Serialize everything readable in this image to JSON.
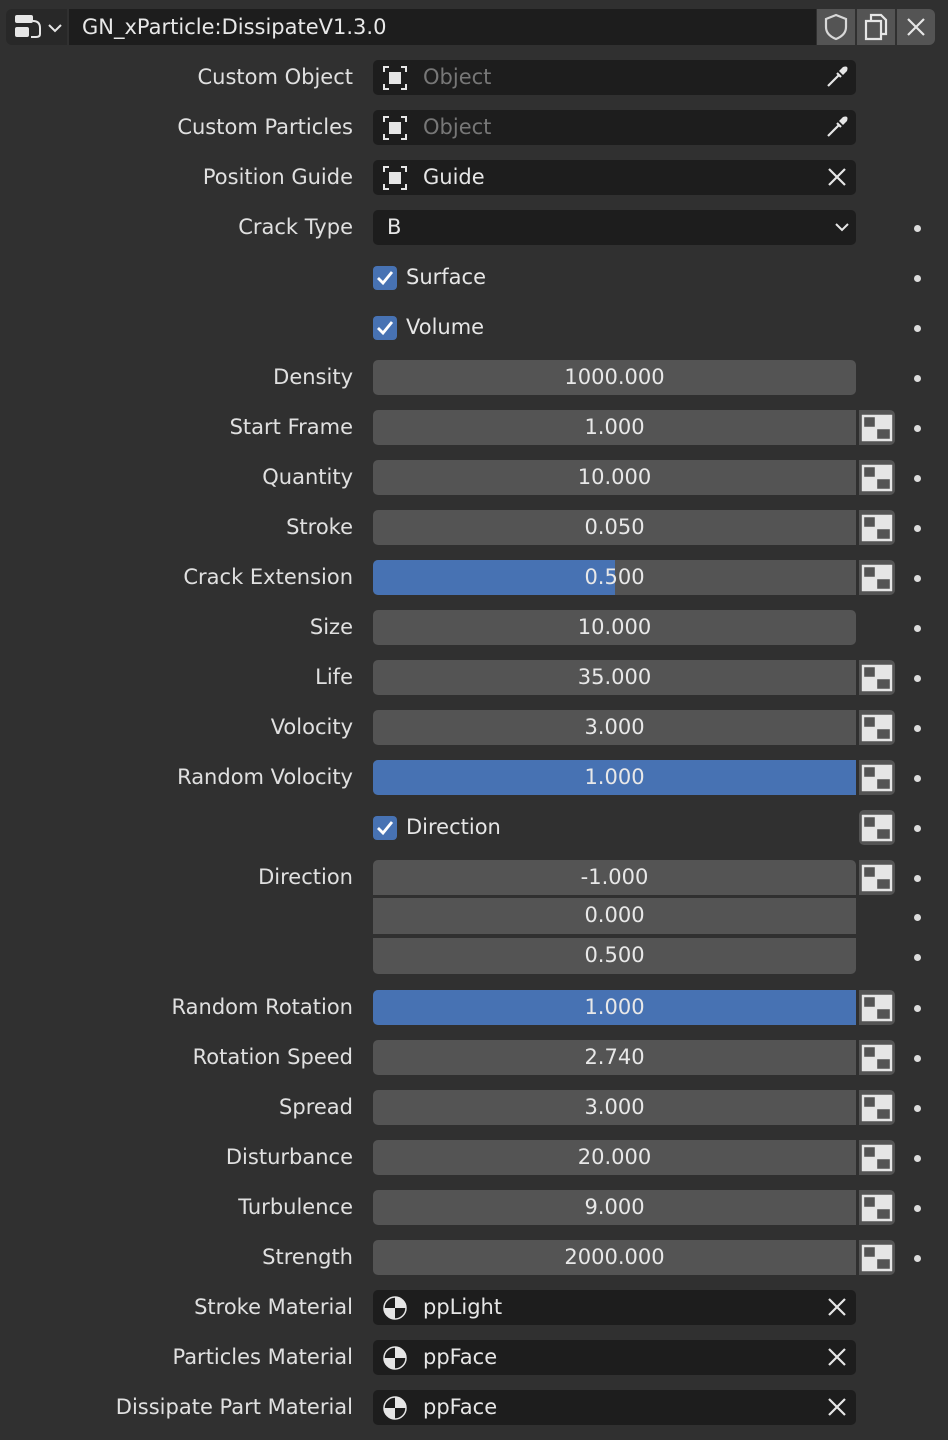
{
  "header": {
    "datablock_name": "GN_xParticle:DissipateV1.3.0",
    "icons": [
      "node-tree-icon",
      "chevron-down-icon",
      "fake-user-shield-icon",
      "duplicate-icon",
      "close-icon"
    ]
  },
  "object_fields": [
    {
      "label": "Custom Object",
      "value": "",
      "placeholder": "Object",
      "right_icon": "eyedropper-icon"
    },
    {
      "label": "Custom Particles",
      "value": "",
      "placeholder": "Object",
      "right_icon": "eyedropper-icon"
    },
    {
      "label": "Position Guide",
      "value": "Guide",
      "placeholder": "",
      "right_icon": "close-icon"
    }
  ],
  "crack_type": {
    "label": "Crack Type",
    "value": "B"
  },
  "checks": {
    "surface": {
      "label": "Surface",
      "checked": true
    },
    "volume": {
      "label": "Volume",
      "checked": true
    },
    "direction": {
      "label": "Direction",
      "checked": true
    }
  },
  "numbers": [
    {
      "label": "Density",
      "value": "1000.000",
      "fill": 0,
      "anim": false
    },
    {
      "label": "Start Frame",
      "value": "1.000",
      "fill": 0,
      "anim": true
    },
    {
      "label": "Quantity",
      "value": "10.000",
      "fill": 0,
      "anim": true
    },
    {
      "label": "Stroke",
      "value": "0.050",
      "fill": 0,
      "anim": true
    },
    {
      "label": "Crack Extension",
      "value": "0.500",
      "fill": 0.5,
      "anim": true
    },
    {
      "label": "Size",
      "value": "10.000",
      "fill": 0,
      "anim": false
    },
    {
      "label": "Life",
      "value": "35.000",
      "fill": 0,
      "anim": true
    },
    {
      "label": "Volocity",
      "value": "3.000",
      "fill": 0,
      "anim": true
    },
    {
      "label": "Random Volocity",
      "value": "1.000",
      "fill": 1,
      "anim": true
    }
  ],
  "direction_vector": {
    "label": "Direction",
    "values": [
      "-1.000",
      "0.000",
      "0.500"
    ]
  },
  "numbers2": [
    {
      "label": "Random Rotation",
      "value": "1.000",
      "fill": 1,
      "anim": true
    },
    {
      "label": "Rotation Speed",
      "value": "2.740",
      "fill": 0,
      "anim": true
    },
    {
      "label": "Spread",
      "value": "3.000",
      "fill": 0,
      "anim": true
    },
    {
      "label": "Disturbance",
      "value": "20.000",
      "fill": 0,
      "anim": true
    },
    {
      "label": "Turbulence",
      "value": "9.000",
      "fill": 0,
      "anim": true
    },
    {
      "label": "Strength",
      "value": "2000.000",
      "fill": 0,
      "anim": true
    }
  ],
  "materials": [
    {
      "label": "Stroke Material",
      "value": "ppLight"
    },
    {
      "label": "Particles Material",
      "value": "ppFace"
    },
    {
      "label": "Dissipate Part Material",
      "value": "ppFace"
    }
  ],
  "colors": {
    "accent": "#4772b3",
    "field": "#545454",
    "dark_field": "#1d1d1d",
    "background": "#303030"
  }
}
